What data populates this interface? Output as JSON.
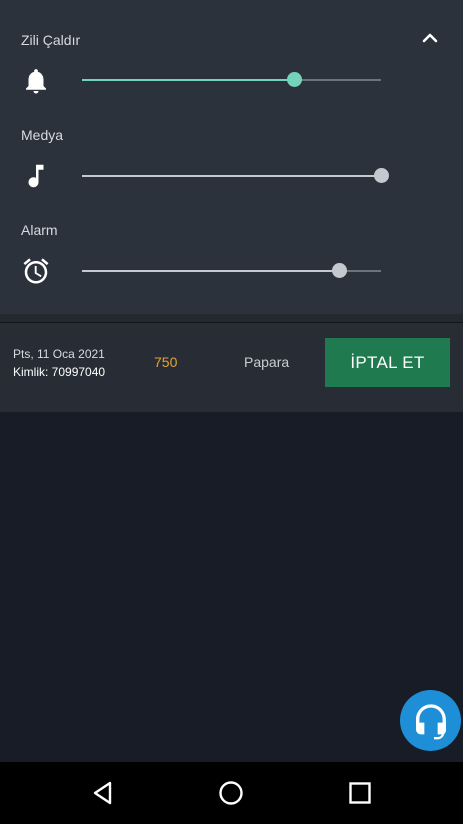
{
  "volume": {
    "sliders": [
      {
        "label": "Zili Çaldır",
        "icon": "bell-icon",
        "level": 0.71,
        "color": "#73d4bc"
      },
      {
        "label": "Medya",
        "icon": "music-note-icon",
        "level": 1.0,
        "color": "#c4c9cf"
      },
      {
        "label": "Alarm",
        "icon": "alarm-clock-icon",
        "level": 0.86,
        "color": "#c4c9cf"
      }
    ],
    "collapse_icon": "chevron-up-icon"
  },
  "transaction": {
    "date": "Pts, 11 Oca 2021",
    "id_text": "Kimlik: 70997040",
    "amount": "750",
    "amount_color": "#e3a632",
    "method": "Papara",
    "cancel_label": "İPTAL ET",
    "cancel_color": "#1f7a4f"
  },
  "support": {
    "icon": "headset-icon",
    "color": "#1e8fd6"
  },
  "navbar": {
    "back": "back-icon",
    "home": "home-icon",
    "recents": "recents-icon"
  }
}
